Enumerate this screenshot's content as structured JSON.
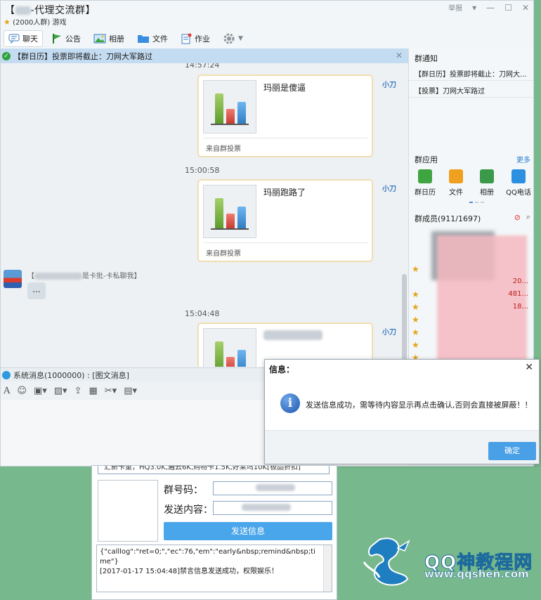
{
  "window": {
    "title": "-代理交流群】",
    "title_prefix": "【",
    "subtitle": "(2000人群) 游戏",
    "report": "举报"
  },
  "toolbar": {
    "chat": "聊天",
    "announcement": "公告",
    "album": "相册",
    "files": "文件",
    "homework": "作业"
  },
  "notice_bar": {
    "text": "【群日历】投票即将截止：刀网大军路过"
  },
  "chat": {
    "messages": [
      {
        "time": "14:57:24",
        "title": "玛丽是傻逼",
        "from": "来自群投票",
        "sender": "小刀"
      },
      {
        "time": "15:00:58",
        "title": "玛丽跑路了",
        "from": "来自群投票",
        "sender": "小刀"
      },
      {
        "time": "15:04:48",
        "title": "",
        "from": "",
        "sender": "小刀"
      }
    ],
    "member_msg": {
      "name_open": "【",
      "name_tail": "是卡批-卡私聊我】",
      "bubble": "..."
    }
  },
  "system_message": {
    "text": "系统消息(1000000) : [图文消息]"
  },
  "right_panel": {
    "notice_heading": "群通知",
    "notices": [
      "【群日历】投票即将截止：刀网大...",
      "【投票】刀网大军路过"
    ],
    "apps_heading": "群应用",
    "more": "更多",
    "apps": [
      "群日历",
      "文件",
      "相册",
      "QQ电话"
    ],
    "members_heading": "群成员(911/1697)",
    "member_numbers": [
      "20...",
      "481...",
      "18..."
    ]
  },
  "dialog": {
    "title": "信息：",
    "message": "发送信息成功，需等待内容显示再点击确认,否则会直接被屏蔽！！",
    "ok": "确定"
  },
  "tool": {
    "banner": "汇新卡重，HQ3.0K,遍云6K,购物卡1.5K,好莱坞10K[极品折扣]",
    "group_label": "群号码：",
    "content_label": "发送内容：",
    "send_button": "发送信息",
    "log_lines": [
      "{\"calllog\":\"ret=0;\",\"ec\":76,\"em\":\"early&nbsp;remind&nbsp;time\"}",
      "[2017-01-17 15:04:48]禁言信息发送成功，权限娱乐！"
    ]
  },
  "watermark": {
    "title": "QQ神教程网",
    "url": "www.qqshen.com"
  },
  "colors": {
    "accent": "#4aa6ea",
    "notice_bar": "#c4dcf2",
    "card_border": "#f0ddb0",
    "background": "#77b98c"
  }
}
